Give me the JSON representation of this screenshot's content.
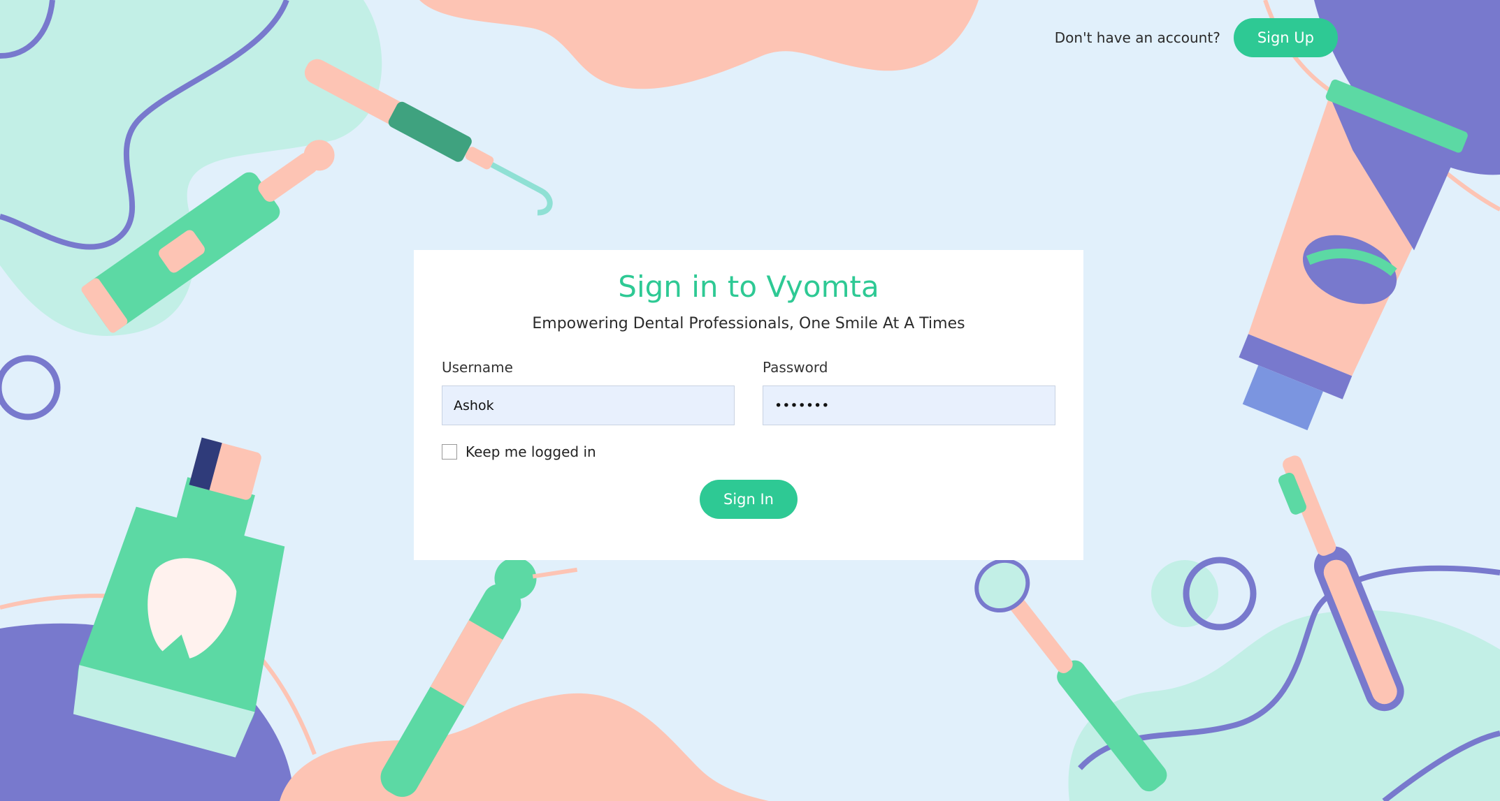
{
  "header": {
    "prompt": "Don't have an account?",
    "signup_label": "Sign Up"
  },
  "login": {
    "title": "Sign in to Vyomta",
    "subtitle": "Empowering Dental Professionals, One Smile At A Times",
    "username_label": "Username",
    "username_value": "Ashok",
    "password_label": "Password",
    "password_value": "•••••••",
    "keep_logged_in_label": "Keep me logged in",
    "keep_logged_in_checked": false,
    "signin_label": "Sign In"
  },
  "illustrations": [
    "electric-toothbrush-icon",
    "dental-probe-icon",
    "toothpaste-tube-icon",
    "mouthwash-bottle-icon",
    "dental-drill-icon",
    "dental-mirror-icon",
    "toothbrush-icon"
  ],
  "colors": {
    "background": "#e1f0fb",
    "accent": "#2ec994",
    "mint": "#c2efe6",
    "peach": "#fdc4b4",
    "purple": "#7879cd"
  }
}
